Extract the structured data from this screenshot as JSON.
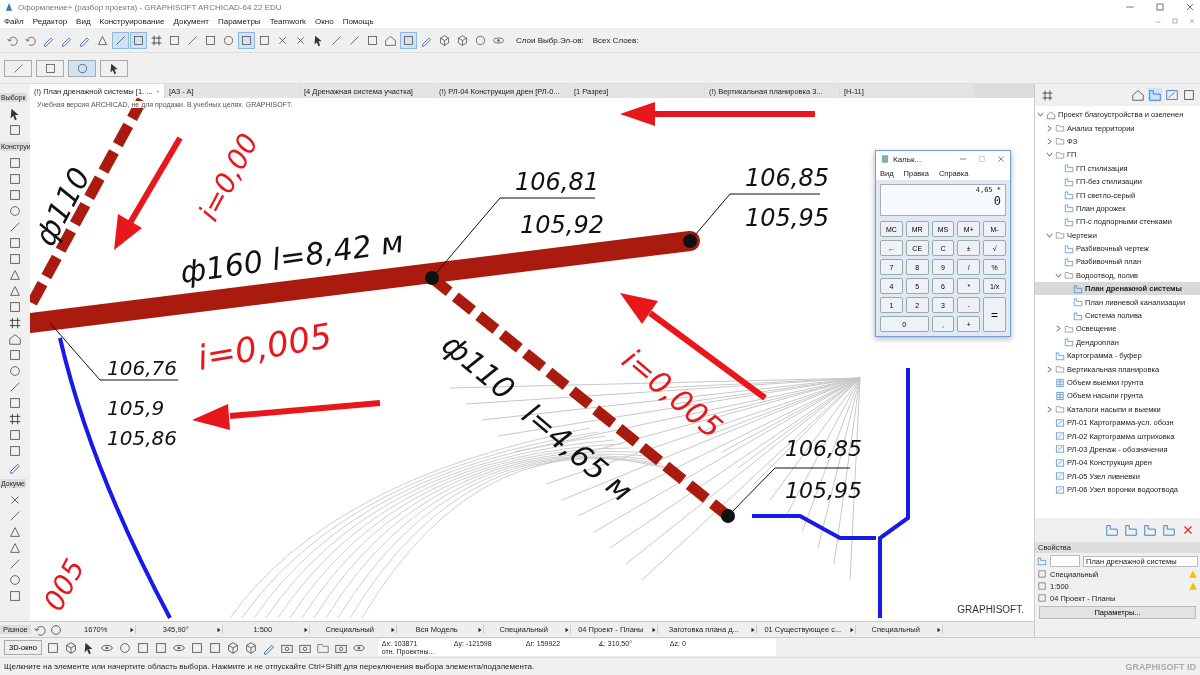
{
  "window": {
    "title": "Оформление+ (разбор проекта) - GRAPHISOFT ARCHICAD-64 22 EDU"
  },
  "menu": [
    "Файл",
    "Редактор",
    "Вид",
    "Конструирование",
    "Документ",
    "Параметры",
    "Teamwork",
    "Окно",
    "Помощь"
  ],
  "toolbar": {
    "row_1": [
      {
        "pressed": false
      },
      {
        "pressed": false
      },
      {
        "pressed": false
      },
      {
        "pressed": false
      },
      {
        "pressed": false
      },
      {
        "pressed": false
      },
      {
        "pressed": true
      },
      {
        "pressed": true
      },
      {
        "pressed": false
      },
      {
        "pressed": false
      },
      {
        "pressed": false
      },
      {
        "pressed": false
      },
      {
        "pressed": false
      },
      {
        "pressed": true
      },
      {
        "pressed": false
      },
      {
        "pressed": false
      },
      {
        "pressed": false
      },
      {
        "pressed": false
      },
      {
        "pressed": false
      },
      {
        "pressed": false
      },
      {
        "pressed": false
      },
      {
        "pressed": false
      },
      {
        "pressed": true
      },
      {
        "pressed": false
      },
      {
        "pressed": false
      },
      {
        "pressed": false
      },
      {
        "pressed": false
      },
      {
        "pressed": false
      }
    ],
    "layers_label": "Слои Выбр.Эл-ов:",
    "all_layers_label": "Всех Слоев:",
    "row_2": [
      {
        "pressed": false
      },
      {
        "pressed": false
      },
      {
        "pressed": true
      },
      {
        "pressed": false
      }
    ]
  },
  "tabs": [
    {
      "label": "(!) План дренажной системы [1. ...",
      "selected": true,
      "closable": true
    },
    {
      "label": "[A3 - A]",
      "selected": false,
      "closable": false
    },
    {
      "label": "[4 Дренажная система участка]",
      "selected": false,
      "closable": false
    },
    {
      "label": "(!) РЛ-04 Конструкция дрен [РЛ-0...",
      "selected": false,
      "closable": false
    },
    {
      "label": "[1 Разрез]",
      "selected": false,
      "closable": false
    },
    {
      "label": "(!) Вертикальная планировка 3...",
      "selected": false,
      "closable": false
    },
    {
      "label": "[Н-11]",
      "selected": false,
      "closable": false
    }
  ],
  "toolbox": [
    "Выборк",
    "Конструи",
    "Докуме"
  ],
  "canvas": {
    "notice": "Учебная версия ARCHICAD, не для продажи. В учебных целях. GRAPHISOFT.",
    "annotations": [
      {
        "text": "106,81",
        "kind": "elevation"
      },
      {
        "text": "105,92",
        "kind": "elevation"
      },
      {
        "text": "106,85",
        "kind": "elevation"
      },
      {
        "text": "105,95",
        "kind": "elevation"
      },
      {
        "text": "ф160  l=8,42 м",
        "kind": "pipe"
      },
      {
        "text": "106,76",
        "kind": "elevation"
      },
      {
        "text": "105,9",
        "kind": "elevation"
      },
      {
        "text": "105,86",
        "kind": "elevation"
      },
      {
        "text": "i=0,005",
        "kind": "slope"
      },
      {
        "text": "ф110",
        "kind": "pipe"
      },
      {
        "text": "l=4,65 м",
        "kind": "pipe"
      },
      {
        "text": "i=0,005",
        "kind": "slope"
      },
      {
        "text": "106,85",
        "kind": "elevation"
      },
      {
        "text": "105,95",
        "kind": "elevation"
      },
      {
        "text": "ф110",
        "kind": "pipe"
      },
      {
        "text": "i=0,00",
        "kind": "slope"
      },
      {
        "text": "005",
        "kind": "slope"
      }
    ],
    "brand": "GRAPHISOFT."
  },
  "calculator": {
    "title": "Кальк...",
    "menu": [
      "Вид",
      "Правка",
      "Справка"
    ],
    "expression": "4,65 *",
    "display": "0",
    "keys": [
      "MC",
      "MR",
      "MS",
      "M+",
      "M-",
      "←",
      "CE",
      "C",
      "±",
      "√",
      "7",
      "8",
      "9",
      "/",
      "%",
      "4",
      "5",
      "6",
      "*",
      "1/x",
      "1",
      "2",
      "3",
      "-",
      "=",
      "0",
      ",",
      "+"
    ]
  },
  "navigator": {
    "tree": [
      {
        "label": "Проект благоустройства и озеленен",
        "kind": "project",
        "expanded": true,
        "selected": false,
        "children": [
          {
            "label": "Анализ территории",
            "kind": "folder",
            "expanded": false,
            "selected": false
          },
          {
            "label": "ФЗ",
            "kind": "folder",
            "expanded": false,
            "selected": false
          },
          {
            "label": "ГП",
            "kind": "folder",
            "expanded": true,
            "selected": false,
            "children": [
              {
                "label": "ГП стилизация",
                "kind": "view",
                "selected": false
              },
              {
                "label": "ГП-без стилизации",
                "kind": "view",
                "selected": false
              },
              {
                "label": "ГП светло-серый",
                "kind": "view",
                "selected": false
              },
              {
                "label": "План дорожек",
                "kind": "view",
                "selected": false
              },
              {
                "label": "ГП-с подпорными стенками",
                "kind": "view",
                "selected": false
              }
            ]
          },
          {
            "label": "Чертежи",
            "kind": "folder",
            "expanded": true,
            "selected": false,
            "children": [
              {
                "label": "Разбивочный чертеж",
                "kind": "view",
                "selected": false
              },
              {
                "label": "Разбивочный план",
                "kind": "view",
                "selected": false
              },
              {
                "label": "Водоотвод, полив",
                "kind": "folder",
                "expanded": true,
                "selected": false,
                "children": [
                  {
                    "label": "План дренажной системы",
                    "kind": "view",
                    "selected": true
                  },
                  {
                    "label": "План ливневой канализации",
                    "kind": "view",
                    "selected": false
                  },
                  {
                    "label": "Система полива",
                    "kind": "view",
                    "selected": false
                  }
                ]
              },
              {
                "label": "Освещение",
                "kind": "folder",
                "expanded": false,
                "selected": false
              },
              {
                "label": "Дендроплан",
                "kind": "view",
                "selected": false
              }
            ]
          },
          {
            "label": "Картограмма - буфер",
            "kind": "view",
            "selected": false
          },
          {
            "label": "Вертикальная планировка",
            "kind": "folder",
            "expanded": false,
            "selected": false
          },
          {
            "label": "Объем выемки грунта",
            "kind": "table",
            "selected": false
          },
          {
            "label": "Объем насыпи грунта",
            "kind": "table",
            "selected": false
          },
          {
            "label": "Каталоги насыпи и выемки",
            "kind": "folder",
            "expanded": false,
            "selected": false
          },
          {
            "label": "РЛ-01 Картограмма-усл. обозн",
            "kind": "layout",
            "selected": false
          },
          {
            "label": "РЛ-02 Картограмма штриховка",
            "kind": "layout",
            "selected": false
          },
          {
            "label": "РЛ-03 Дренаж - обозначения",
            "kind": "layout",
            "selected": false
          },
          {
            "label": "РЛ-04 Конструкция дрен",
            "kind": "layout",
            "selected": false
          },
          {
            "label": "РЛ-05  Узел ливневки",
            "kind": "layout",
            "selected": false
          },
          {
            "label": "РЛ-06  Узел воронки водоотвода",
            "kind": "layout",
            "selected": false
          }
        ]
      }
    ]
  },
  "properties": {
    "title": "Свойства",
    "name": "План дренажной системы",
    "rows": [
      {
        "text": "Специальный",
        "warning": true
      },
      {
        "text": "1:500",
        "warning": true
      },
      {
        "text": "04 Проект - Планы",
        "warning": false
      }
    ],
    "button": "Параметры..."
  },
  "view_bar": {
    "label": "Разное",
    "items": [
      "1670%",
      "345,90°",
      "1:500",
      "Специальный",
      "Вся Модель",
      "Специальный",
      "04 Проект - Планы",
      "Заготовка плана д...",
      "01 Существующее с...",
      "Специальный"
    ]
  },
  "bottom_toolbar": {
    "window_button": "3D-окно",
    "coords": [
      "Δx: 103871",
      "Δy: -121598",
      "Δr: 159922",
      "∡: 310,50°",
      "Δz: 0"
    ],
    "reference": "отн. Проектны..."
  },
  "status_bar": {
    "message": "Щелкните на элементе или начертите область выбора. Нажмите и не отпускайте Ctrl+Shift для переключения выбора элемента/подэлемента.",
    "brand": "GRAPHISOFT ID"
  }
}
